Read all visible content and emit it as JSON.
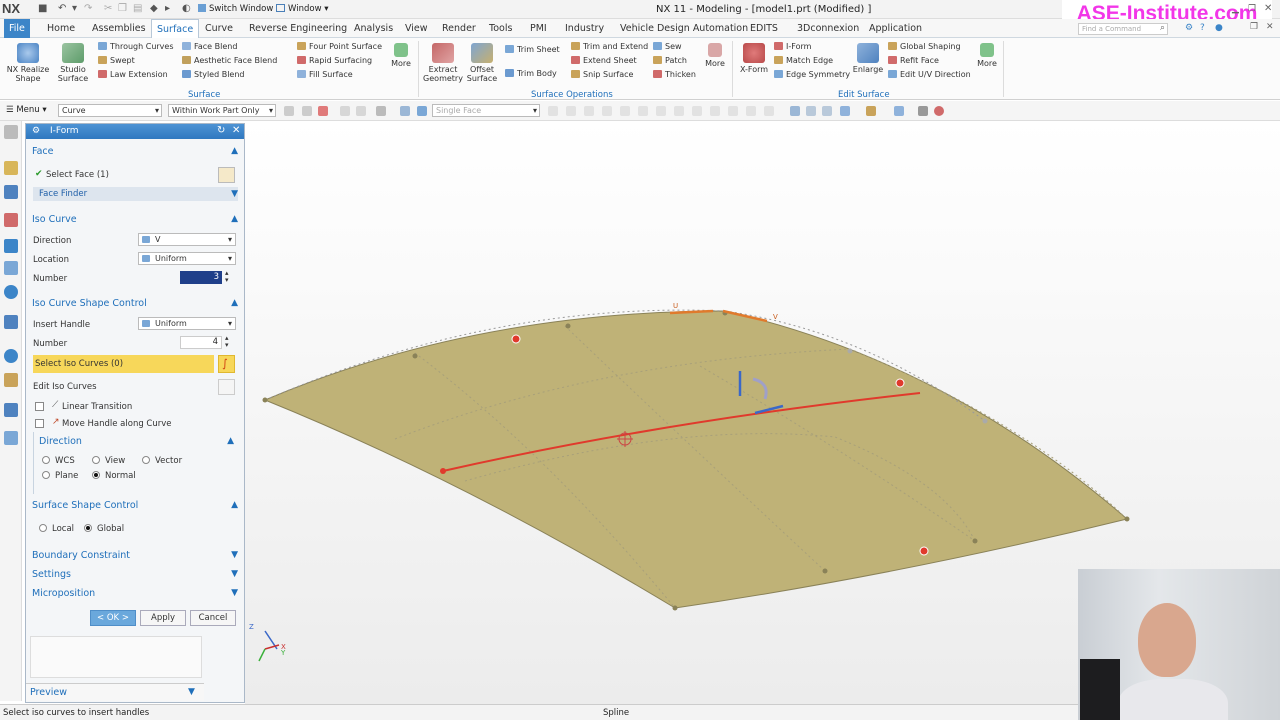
{
  "window": {
    "logo": "NX",
    "switch_window": "Switch Window",
    "window_menu": "Window",
    "title": "NX 11 - Modeling - [model1.prt (Modified) ]",
    "brand": "ASE-Institute.com",
    "find_command": "Find a Command"
  },
  "menu_tabs": [
    "File",
    "Home",
    "Assemblies",
    "Surface",
    "Curve",
    "Reverse Engineering",
    "Analysis",
    "View",
    "Render",
    "Tools",
    "PMI",
    "Industry",
    "Vehicle Design Automation",
    "EDITS",
    "3Dconnexion",
    "Application"
  ],
  "ribbon": {
    "nx_realize": "NX Realize Shape",
    "studio_surface": "Studio Surface",
    "through_curves": "Through Curves",
    "swept": "Swept",
    "law_extension": "Law Extension",
    "face_blend": "Face Blend",
    "aesthetic_face_blend": "Aesthetic Face Blend",
    "styled_blend": "Styled Blend",
    "four_point_surface": "Four Point Surface",
    "rapid_surfacing": "Rapid Surfacing",
    "fill_surface": "Fill Surface",
    "more": "More",
    "extract_geometry": "Extract Geometry",
    "offset_surface": "Offset Surface",
    "trim_sheet": "Trim Sheet",
    "trim_body": "Trim Body",
    "trim_and_extend": "Trim and Extend",
    "extend_sheet": "Extend Sheet",
    "snip_surface": "Snip Surface",
    "sew": "Sew",
    "patch": "Patch",
    "thicken": "Thicken",
    "x_form": "X-Form",
    "i_form": "I-Form",
    "match_edge": "Match Edge",
    "edge_symmetry": "Edge Symmetry",
    "enlarge": "Enlarge",
    "global_shaping": "Global Shaping",
    "refit_face": "Refit Face",
    "edit_uv_direction": "Edit U/V Direction",
    "group_surface": "Surface",
    "group_surface_operations": "Surface Operations",
    "group_edit_surface": "Edit Surface"
  },
  "toolbar2": {
    "menu": "Menu",
    "filter": "Curve",
    "scope": "Within Work Part Only",
    "face_rule": "Single Face"
  },
  "dialog": {
    "title": "I-Form",
    "face_section": "Face",
    "select_face": "Select Face (1)",
    "face_finder": "Face Finder",
    "iso_curve_section": "Iso Curve",
    "direction_label": "Direction",
    "direction_value": "V",
    "location_label": "Location",
    "location_value": "Uniform",
    "number_label": "Number",
    "number_value": "3",
    "shape_control_section": "Iso Curve Shape Control",
    "insert_handle_label": "Insert Handle",
    "insert_handle_value": "Uniform",
    "number2_label": "Number",
    "number2_value": "4",
    "select_iso_curves": "Select Iso Curves (0)",
    "edit_iso_curves": "Edit Iso Curves",
    "linear_transition": "Linear Transition",
    "move_handle": "Move Handle along Curve",
    "direction_section": "Direction",
    "wcs": "WCS",
    "view": "View",
    "vector": "Vector",
    "plane": "Plane",
    "normal": "Normal",
    "surface_shape_section": "Surface Shape Control",
    "local": "Local",
    "global": "Global",
    "boundary_section": "Boundary Constraint",
    "settings_section": "Settings",
    "microposition_section": "Microposition",
    "ok": "< OK >",
    "apply": "Apply",
    "cancel": "Cancel",
    "preview": "Preview"
  },
  "viewport": {
    "u_label": "U",
    "v_label": "V",
    "csys_x": "X",
    "csys_y": "Y",
    "csys_z": "Z"
  },
  "status": {
    "prompt": "Select iso curves to insert handles",
    "selection": "Spline"
  },
  "colors": {
    "surface": "#bfb277",
    "iso_curve": "#e03a2c",
    "accent": "#1f6fba",
    "highlight": "#f7d75a",
    "brand": "#f236e8"
  }
}
